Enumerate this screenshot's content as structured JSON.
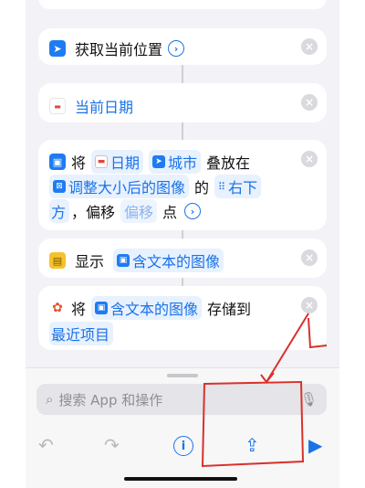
{
  "blocks": {
    "get_location": {
      "label": "获取当前位置"
    },
    "current_date": {
      "label": "当前日期"
    },
    "overlay": {
      "word_jiang": "将",
      "token_date": "日期",
      "token_city": "城市",
      "word_stack": "叠放在",
      "token_resized": "调整大小后的图像",
      "word_de": "的",
      "token_position_a": "右下",
      "token_position_b": "方",
      "word_offset": "，偏移",
      "token_offset": "偏移",
      "word_point": "点"
    },
    "show": {
      "label": "显示",
      "token": "含文本的图像"
    },
    "save": {
      "word_jiang": "将",
      "token": "含文本的图像",
      "word_saveto": "存储到",
      "album": "最近项目"
    }
  },
  "bottom_bar": {
    "search_placeholder": "搜索 App 和操作"
  },
  "colors": {
    "accent": "#1a73e8",
    "annotation_red": "#d9312b"
  }
}
